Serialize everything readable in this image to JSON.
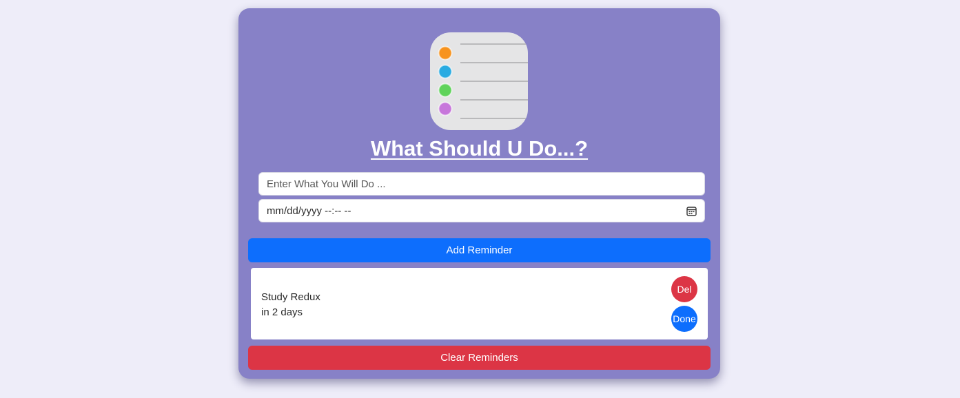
{
  "app": {
    "title": "What Should U Do...?",
    "logo_icon": "reminders-list-icon",
    "logo_dot_colors": [
      "#f7931e",
      "#29abe2",
      "#5fd35a",
      "#c776db"
    ]
  },
  "form": {
    "task_placeholder": "Enter What You Will Do ...",
    "task_value": "",
    "date_placeholder": "mm/dd/yyyy --:-- --",
    "date_icon": "calendar-icon",
    "add_label": "Add Reminder"
  },
  "reminders": [
    {
      "text": "Study Redux",
      "due": "in 2 days",
      "delete_label": "Del",
      "done_label": "Done"
    }
  ],
  "footer": {
    "clear_label": "Clear Reminders"
  },
  "colors": {
    "card": "#8781c7",
    "page_background": "#eeedf9",
    "primary": "#0d6efd",
    "danger": "#dc3545"
  }
}
